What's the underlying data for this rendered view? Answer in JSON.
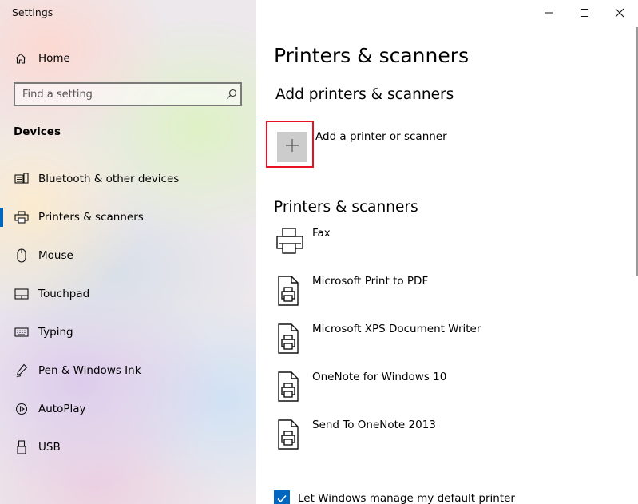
{
  "window": {
    "title": "Settings"
  },
  "sidebar": {
    "home_label": "Home",
    "search_placeholder": "Find a setting",
    "section": "Devices",
    "items": [
      {
        "label": "Bluetooth & other devices",
        "icon": "bluetooth-devices-icon"
      },
      {
        "label": "Printers & scanners",
        "icon": "printer-icon",
        "active": true
      },
      {
        "label": "Mouse",
        "icon": "mouse-icon"
      },
      {
        "label": "Touchpad",
        "icon": "touchpad-icon"
      },
      {
        "label": "Typing",
        "icon": "keyboard-icon"
      },
      {
        "label": "Pen & Windows Ink",
        "icon": "pen-icon"
      },
      {
        "label": "AutoPlay",
        "icon": "autoplay-icon"
      },
      {
        "label": "USB",
        "icon": "usb-icon"
      }
    ]
  },
  "main": {
    "title": "Printers & scanners",
    "add_section_title": "Add printers & scanners",
    "add_label": "Add a printer or scanner",
    "list_title": "Printers & scanners",
    "devices": [
      {
        "name": "Fax",
        "icon": "fax-icon"
      },
      {
        "name": "Microsoft Print to PDF",
        "icon": "printer-document-icon"
      },
      {
        "name": "Microsoft XPS Document Writer",
        "icon": "printer-document-icon"
      },
      {
        "name": "OneNote for Windows 10",
        "icon": "printer-document-icon"
      },
      {
        "name": "Send To OneNote 2013",
        "icon": "printer-document-icon"
      }
    ],
    "default_printer_checkbox": {
      "label": "Let Windows manage my default printer",
      "checked": true
    }
  },
  "colors": {
    "accent": "#0067c0",
    "highlight_border": "#e81123",
    "add_button_bg": "#cccccc"
  }
}
